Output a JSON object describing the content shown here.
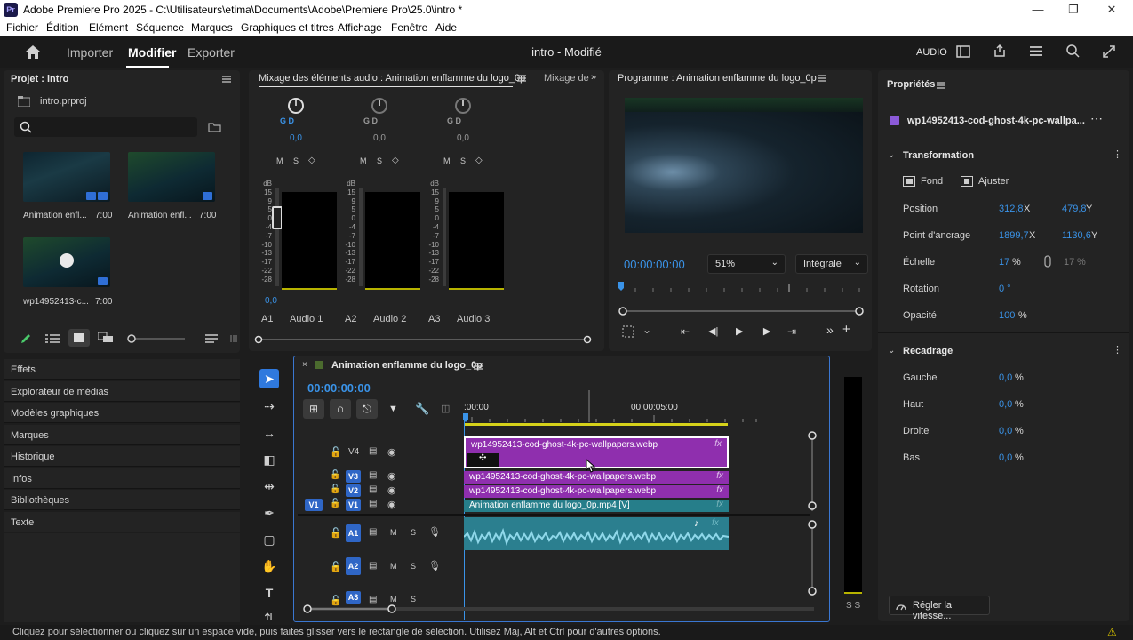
{
  "window": {
    "logo": "Pr",
    "title": "Adobe Premiere Pro 2025 - C:\\Utilisateurs\\etima\\Documents\\Adobe\\Premiere Pro\\25.0\\intro *"
  },
  "menu": [
    "Fichier",
    "Édition",
    "Elément",
    "Séquence",
    "Marques",
    "Graphiques et titres",
    "Affichage",
    "Fenêtre",
    "Aide"
  ],
  "header": {
    "tabs": [
      "Importer",
      "Modifier",
      "Exporter"
    ],
    "active_tab": "Modifier",
    "project_status": "intro - Modifié",
    "audio_label": "AUDIO"
  },
  "project": {
    "title": "Projet : intro",
    "file": "intro.prproj",
    "items": [
      {
        "name": "Animation enfl...",
        "duration": "7:00"
      },
      {
        "name": "Animation enfl...",
        "duration": "7:00"
      },
      {
        "name": "wp14952413-c...",
        "duration": "7:00"
      }
    ]
  },
  "left_panels": [
    "Effets",
    "Explorateur de médias",
    "Modèles graphiques",
    "Marques",
    "Historique",
    "Infos",
    "Bibliothèques",
    "Texte"
  ],
  "mixer": {
    "tab_active": "Mixage des éléments audio : Animation enflamme du logo_0p",
    "tab_other": "Mixage de",
    "pan_label": "G    D",
    "channels": [
      {
        "id": "A1",
        "name": "Audio 1",
        "pan": "0,0",
        "vol": "0,0"
      },
      {
        "id": "A2",
        "name": "Audio 2",
        "pan": "0,0"
      },
      {
        "id": "A3",
        "name": "Audio 3",
        "pan": "0,0"
      }
    ],
    "msk": [
      "M",
      "S"
    ],
    "scale": [
      "dB",
      "15",
      "9",
      "5",
      "0",
      "-4",
      "-7",
      "-10",
      "-13",
      "-17",
      "-22",
      "-28"
    ]
  },
  "program": {
    "title": "Programme : Animation enflamme du logo_0p",
    "timecode": "00:00:00:00",
    "zoom": "51%",
    "quality": "Intégrale"
  },
  "timeline": {
    "sequence_name": "Animation enflamme du logo_0p",
    "timecode": "00:00:00:00",
    "ruler": [
      ":00:00",
      "00:00:05:00"
    ],
    "video_tracks": [
      {
        "id": "V4",
        "clip": "wp14952413-cod-ghost-4k-pc-wallpapers.webp",
        "fx": "fx"
      },
      {
        "id": "V3",
        "clip": "wp14952413-cod-ghost-4k-pc-wallpapers.webp",
        "fx": "fx"
      },
      {
        "id": "V2",
        "clip": "wp14952413-cod-ghost-4k-pc-wallpapers.webp",
        "fx": "fx"
      },
      {
        "id": "V1",
        "clip": "Animation enflamme du logo_0p.mp4 [V]",
        "fx": "fx"
      }
    ],
    "source_patch": "V1",
    "audio_tracks": [
      {
        "id": "A1",
        "m": "M",
        "s": "S"
      },
      {
        "id": "A2",
        "m": "M",
        "s": "S"
      },
      {
        "id": "A3",
        "m": "M",
        "s": "S"
      }
    ],
    "meter_labels": "S  S"
  },
  "properties": {
    "title": "Propriétés",
    "clip_name": "wp14952413-cod-ghost-4k-pc-wallpa...",
    "transform": {
      "label": "Transformation",
      "fill": "Fond",
      "fit": "Ajuster",
      "position_label": "Position",
      "position_x": "312,8",
      "position_y": "479,8",
      "anchor_label": "Point d'ancrage",
      "anchor_x": "1899,7",
      "anchor_y": "1130,6",
      "scale_label": "Échelle",
      "scale": "17",
      "scale_h": "17",
      "rotation_label": "Rotation",
      "rotation": "0 °",
      "opacity_label": "Opacité",
      "opacity": "100"
    },
    "crop": {
      "label": "Recadrage",
      "left_label": "Gauche",
      "left": "0,0",
      "top_label": "Haut",
      "top": "0,0",
      "right_label": "Droite",
      "right": "0,0",
      "bottom_label": "Bas",
      "bottom": "0,0"
    },
    "speed_button": "Régler la vitesse...",
    "x": "X",
    "y": "Y",
    "pct": "%"
  },
  "status": "Cliquez pour sélectionner ou cliquez sur un espace vide, puis faites glisser vers le rectangle de sélection. Utilisez Maj, Alt et Ctrl pour d'autres options."
}
